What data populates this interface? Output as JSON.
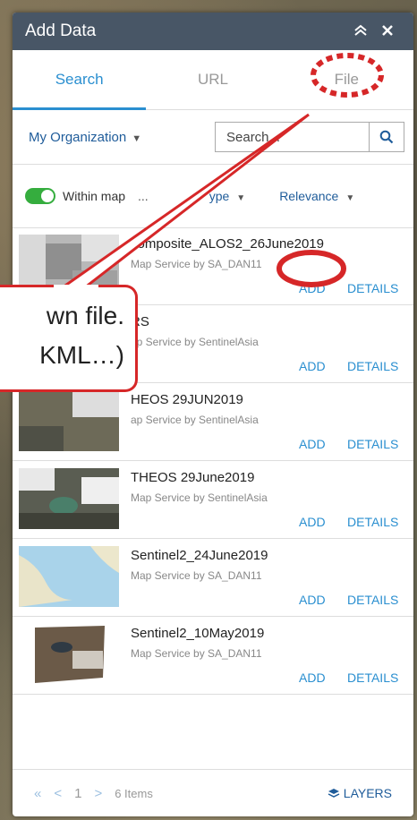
{
  "panel": {
    "title": "Add Data",
    "collapse_icon": "double-chevron-up-icon",
    "close_icon": "close-icon"
  },
  "tabs": [
    {
      "label": "Search",
      "active": true
    },
    {
      "label": "URL",
      "active": false
    },
    {
      "label": "File",
      "active": false
    }
  ],
  "search": {
    "scope": "My Organization",
    "placeholder": "Search..."
  },
  "filters": {
    "within_map_label": "Within map",
    "within_map_on": true,
    "more": "...",
    "type": "ype",
    "sort": "Relevance"
  },
  "items": [
    {
      "name": "composite_ALOS2_26June2019",
      "owner": "Map Service by SA_DAN11",
      "add": "ADD",
      "details": "DETAILS"
    },
    {
      "name": "RS",
      "owner": "ap Service by SentinelAsia",
      "add": "ADD",
      "details": "DETAILS"
    },
    {
      "name": "HEOS 29JUN2019",
      "owner": "ap Service by SentinelAsia",
      "add": "ADD",
      "details": "DETAILS"
    },
    {
      "name": "THEOS 29June2019",
      "owner": "Map Service by SentinelAsia",
      "add": "ADD",
      "details": "DETAILS"
    },
    {
      "name": "Sentinel2_24June2019",
      "owner": "Map Service by SA_DAN11",
      "add": "ADD",
      "details": "DETAILS"
    },
    {
      "name": "Sentinel2_10May2019",
      "owner": "Map Service by SA_DAN11",
      "add": "ADD",
      "details": "DETAILS"
    }
  ],
  "pagination": {
    "first": "«",
    "prev": "<",
    "page": "1",
    "next": ">",
    "count": "6 Items",
    "layers": "LAYERS"
  },
  "callout": {
    "line1": "wn file.",
    "line2": "KML…)"
  },
  "colors": {
    "accent": "#2a8fd0",
    "header": "#485666",
    "annotation": "#d62728"
  }
}
